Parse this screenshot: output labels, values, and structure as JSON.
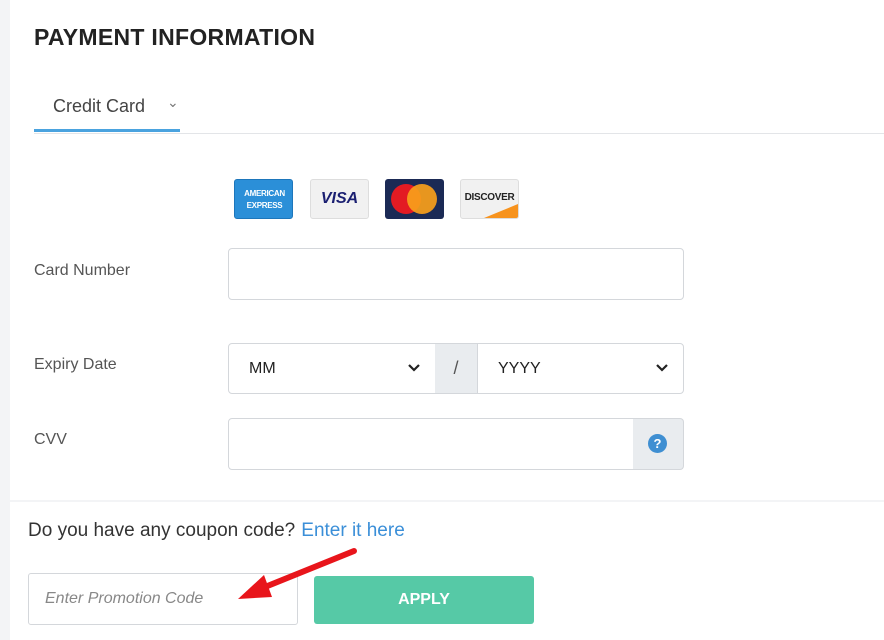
{
  "header": {
    "title": "PAYMENT INFORMATION"
  },
  "tabs": {
    "selected": "Credit Card"
  },
  "card_brands": [
    {
      "name": "amex-card-icon",
      "line1": "AMERICAN",
      "line2": "EXPRESS"
    },
    {
      "name": "visa-card-icon",
      "text": "VISA"
    },
    {
      "name": "mastercard-card-icon"
    },
    {
      "name": "discover-card-icon",
      "text": "DISCOVER"
    }
  ],
  "form": {
    "card_number": {
      "label": "Card Number",
      "value": ""
    },
    "expiry": {
      "label": "Expiry Date",
      "month": "MM",
      "separator": "/",
      "year": "YYYY"
    },
    "cvv": {
      "label": "CVV",
      "value": "",
      "help_icon": "?"
    }
  },
  "coupon": {
    "question": "Do you have any coupon code?",
    "link": "Enter it here",
    "placeholder": "Enter Promotion Code",
    "apply_label": "APPLY"
  },
  "colors": {
    "accent": "#4aa3df",
    "link": "#3b8fd8",
    "apply_button": "#56c9a6",
    "annotation_arrow": "#e8151b"
  }
}
